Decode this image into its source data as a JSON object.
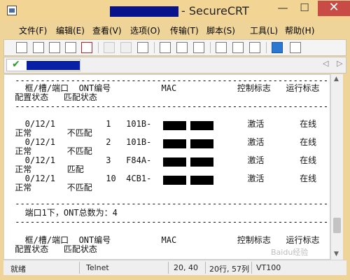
{
  "titlebar": {
    "title": "- SecureCRT",
    "minimize_label": "—",
    "maximize_label": "☐",
    "close_label": "✕"
  },
  "menu": [
    "文件(F)",
    "编辑(E)",
    "查看(V)",
    "选项(O)",
    "传输(T)",
    "脚本(S)",
    "工具(L)",
    "帮助(H)"
  ],
  "toolbar": {
    "items": [
      "new-session-icon",
      "quick-connect-icon",
      "connect-tab-icon",
      "reconnect-icon",
      "disconnect-icon",
      "copy-icon",
      "paste-icon",
      "find-icon",
      "print-icon",
      "print-setup-icon",
      "print-selection-icon",
      "session-options-icon",
      "keymap-icon",
      "sftp-icon",
      "help-icon",
      "screen-icon"
    ]
  },
  "tabs": {
    "active_tab_status": "✔",
    "left_arrow": "◁",
    "right_arrow": "▷"
  },
  "terminal": {
    "lines": [
      " ------------------------------------------------------------------------",
      "   框/槽/端口  ONT编号          MAC            控制标志   运行标志",
      " 配置状态   匹配状态",
      " ------------------------------------------------------------------------",
      "   0/12/1          1   101B-          -        激活       在线",
      " 正常       不匹配",
      "   0/12/1          2   101B-          -        激活       在线",
      " 正常       不匹配",
      "   0/12/1          3   F84A-          -        激活       在线",
      " 正常       匹配",
      "   0/12/1          10  4CB1-          -        激活       在线",
      " 正常       不匹配",
      " ------------------------------------------------------------------------",
      "   端口1下，ONT总数为：4",
      " ------------------------------------------------------------------------",
      "   框/槽/端口  ONT编号          MAC            控制标志   运行标志",
      " 配置状态   匹配状态"
    ]
  },
  "status": {
    "ready": "就绪",
    "protocol": "Telnet",
    "cursor": "20, 40",
    "rows_cols": "20行, 57列",
    "terminal_type": "VT100"
  },
  "colors": {
    "title_bg": "#f2d594",
    "accent_red": "#c94b45",
    "check_green": "#2c9a23",
    "redaction_blue": "#08128a"
  },
  "watermark": "Baidu经验"
}
